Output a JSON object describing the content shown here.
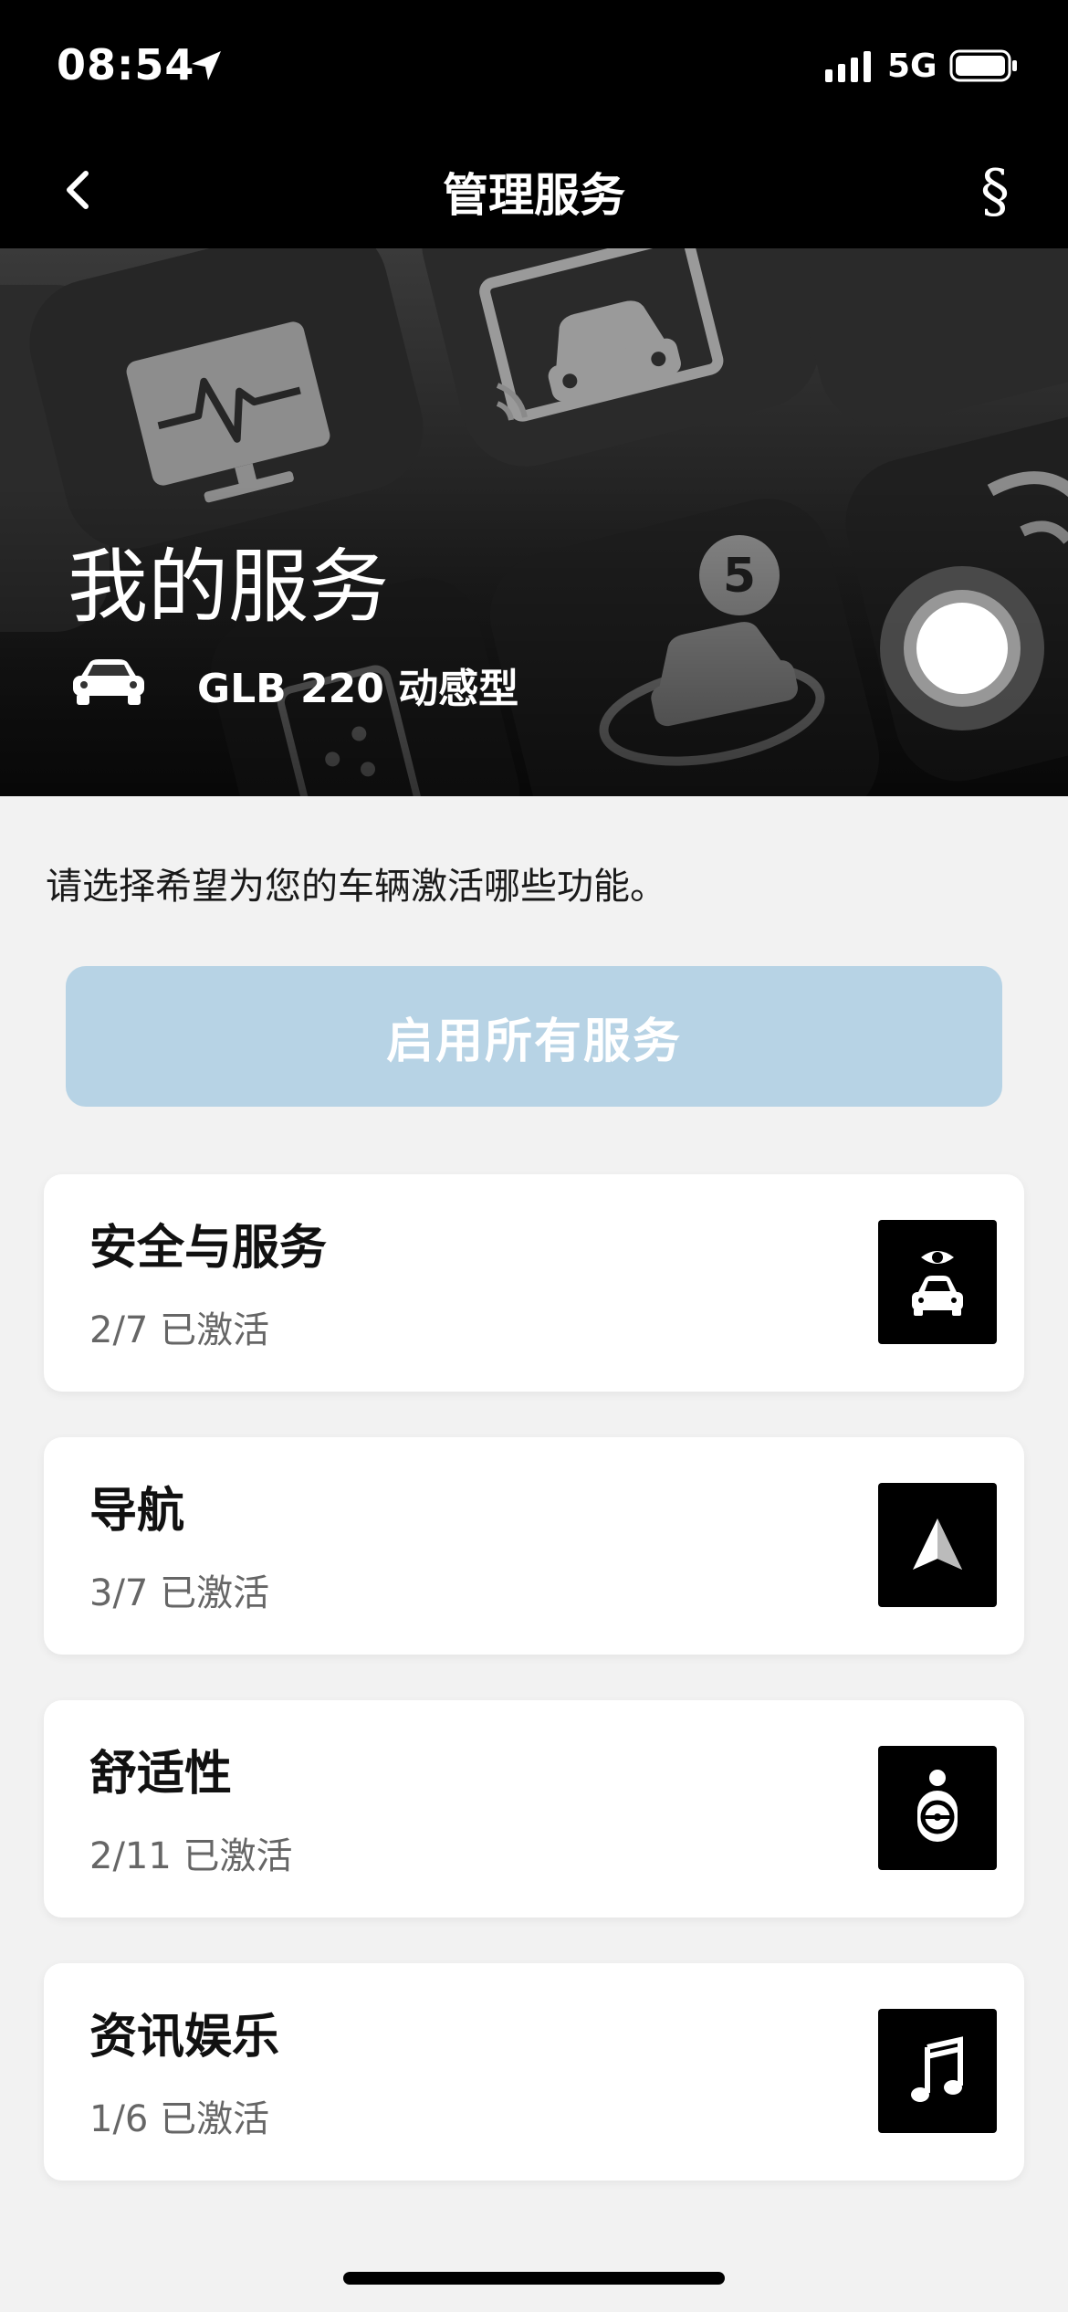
{
  "status_bar": {
    "time": "08:54",
    "network": "5G"
  },
  "nav": {
    "title": "管理服务",
    "legal_symbol": "§"
  },
  "hero": {
    "title": "我的服务",
    "vehicle_name": "GLB 220 动感型",
    "badge_number": "5"
  },
  "intro_text": "请选择希望为您的车辆激活哪些功能。",
  "enable_all_label": "启用所有服务",
  "categories": [
    {
      "title": "安全与服务",
      "status": "2/7 已激活",
      "icon": "car-eye-icon"
    },
    {
      "title": "导航",
      "status": "3/7 已激活",
      "icon": "navigation-arrow-icon"
    },
    {
      "title": "舒适性",
      "status": "2/11 已激活",
      "icon": "driver-seat-icon"
    },
    {
      "title": "资讯娱乐",
      "status": "1/6 已激活",
      "icon": "music-note-icon"
    }
  ],
  "colors": {
    "enable_button": "#b7d3e5",
    "icon_tile": "#000000",
    "background": "#f2f2f2"
  }
}
